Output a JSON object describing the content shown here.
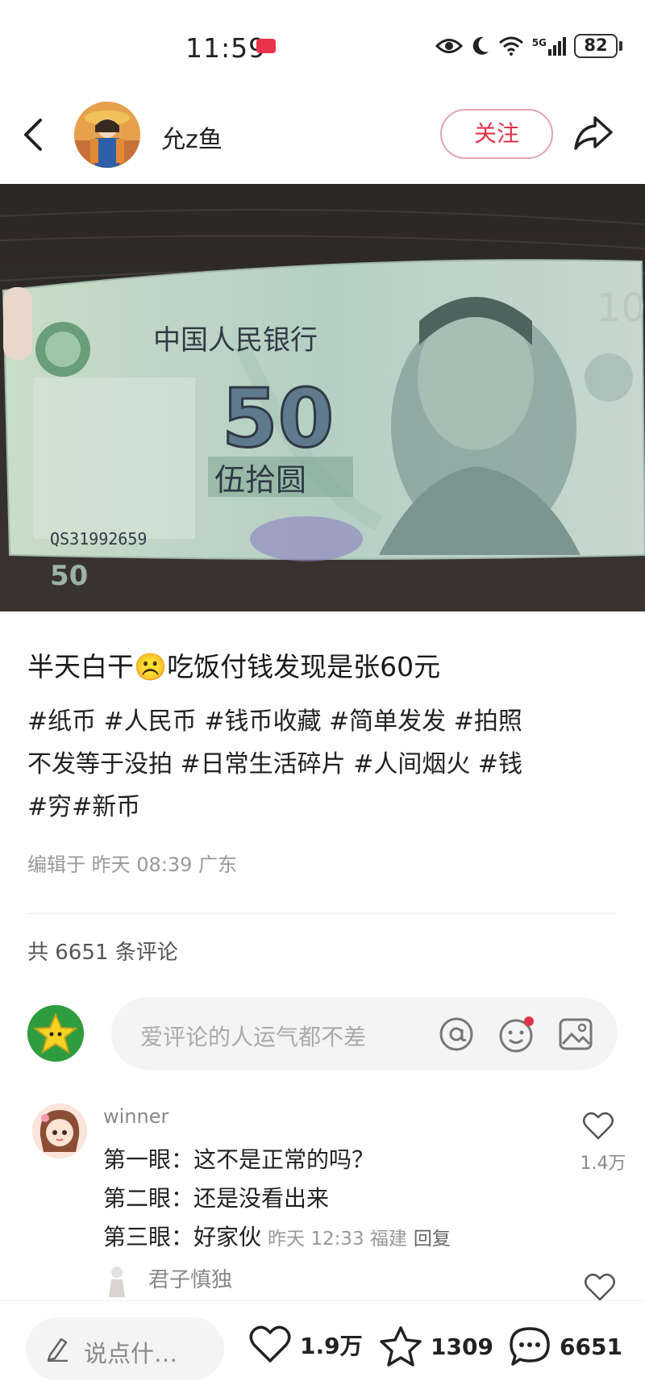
{
  "status_bar": {
    "time": "11:59",
    "battery": "82",
    "network": "5G"
  },
  "header": {
    "username": "允z鱼",
    "follow_label": "关注"
  },
  "post": {
    "title": "半天白干☹️吃饭付钱发现是张60元",
    "tags_line1": "#纸币 #人民币 #钱币收藏 #简单发发 #拍照",
    "tags_line2": "不发等于没拍 #日常生活碎片 #人间烟火 #钱",
    "tags_line3": "#穷#新币",
    "meta": "编辑于 昨天 08:39 广东",
    "banknote": {
      "bank_name": "中国人民银行",
      "denomination": "50",
      "denomination_chinese": "伍拾圆",
      "serial": "QS31992659"
    }
  },
  "comments": {
    "count_label": "共 6651 条评论",
    "input_placeholder": "爱评论的人运气都不差",
    "items": [
      {
        "name": "winner",
        "line1": "第一眼：这不是正常的吗？",
        "line2": "第二眼：还是没看出来",
        "line3": "第三眼：好家伙",
        "meta": "昨天 12:33 福建",
        "reply_label": "回复",
        "likes": "1.4万"
      }
    ],
    "sub_reply": {
      "name": "君子慎独"
    }
  },
  "bottom_bar": {
    "say_placeholder": "说点什…",
    "likes": "1.9万",
    "collects": "1309",
    "comments": "6651"
  },
  "colors": {
    "accent": "#e0334a",
    "gray_text": "#999999"
  }
}
